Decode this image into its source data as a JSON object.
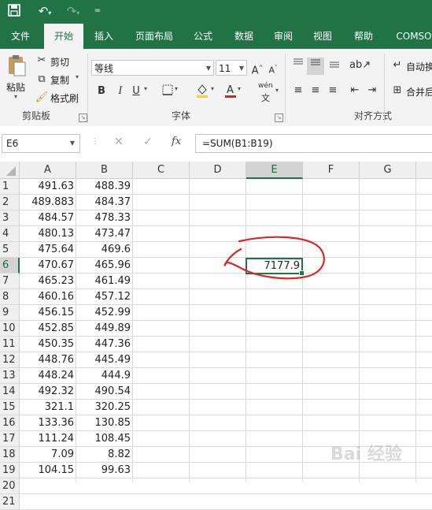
{
  "quick_access": {
    "save_icon": "save-icon",
    "undo_icon": "undo-icon",
    "redo_icon": "redo-icon",
    "customize_icon": "customize-icon"
  },
  "tabs": [
    "文件",
    "开始",
    "插入",
    "页面布局",
    "公式",
    "数据",
    "审阅",
    "视图",
    "帮助",
    "COMSO"
  ],
  "active_tab": "开始",
  "ribbon": {
    "clipboard": {
      "paste": "粘贴",
      "cut": "剪切",
      "copy": "复制",
      "format_painter": "格式刷",
      "group_label": "剪贴板"
    },
    "font": {
      "font_name": "等线",
      "font_size": "11",
      "group_label": "字体",
      "bold": "B",
      "italic": "I",
      "underline": "U",
      "wen": "wén"
    },
    "alignment": {
      "wrap": "自动换",
      "merge": "合并后",
      "group_label": "对齐方式"
    }
  },
  "formula_bar": {
    "name_box": "E6",
    "cancel": "✕",
    "enter": "✓",
    "fx": "fx",
    "formula": "=SUM(B1:B19)"
  },
  "columns": [
    "A",
    "B",
    "C",
    "D",
    "E",
    "F",
    "G"
  ],
  "rows": [
    "1",
    "2",
    "3",
    "4",
    "5",
    "6",
    "7",
    "8",
    "9",
    "10",
    "11",
    "12",
    "13",
    "14",
    "15",
    "16",
    "17",
    "18",
    "19",
    "20",
    "21"
  ],
  "data": [
    [
      "491.63",
      "488.39"
    ],
    [
      "489.883",
      "484.37"
    ],
    [
      "484.57",
      "478.33"
    ],
    [
      "480.13",
      "473.47"
    ],
    [
      "475.64",
      "469.6"
    ],
    [
      "470.67",
      "465.96"
    ],
    [
      "465.23",
      "461.49"
    ],
    [
      "460.16",
      "457.12"
    ],
    [
      "456.15",
      "452.99"
    ],
    [
      "452.85",
      "449.89"
    ],
    [
      "450.35",
      "447.36"
    ],
    [
      "448.76",
      "445.49"
    ],
    [
      "448.24",
      "444.9"
    ],
    [
      "492.32",
      "490.54"
    ],
    [
      "321.1",
      "320.25"
    ],
    [
      "133.36",
      "130.85"
    ],
    [
      "111.24",
      "108.45"
    ],
    [
      "7.09",
      "8.82"
    ],
    [
      "104.15",
      "99.63"
    ]
  ],
  "selected_cell": {
    "ref": "E6",
    "value": "7177.9"
  },
  "colors": {
    "excel_green": "#217346",
    "annotation_red": "#d42a2a"
  }
}
